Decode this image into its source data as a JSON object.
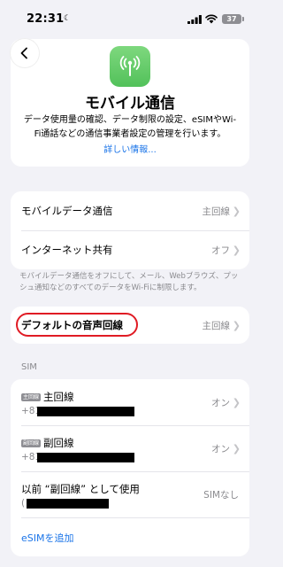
{
  "status_bar": {
    "time": "22:31",
    "battery": "37"
  },
  "header": {
    "title": "モバイル通信",
    "description": "データ使用量の確認、データ制限の設定、eSIMやWi-Fi通話などの通信事業者設定の管理を行います。",
    "learn_more": "詳しい情報..."
  },
  "group1": {
    "rows": [
      {
        "label": "モバイルデータ通信",
        "value": "主回線"
      },
      {
        "label": "インターネット共有",
        "value": "オフ"
      }
    ],
    "footer": "モバイルデータ通信をオフにして、メール、Webブラウズ、プッシュ通知などのすべてのデータをWi-Fiに制限します。"
  },
  "voice_line": {
    "label": "デフォルトの音声回線",
    "value": "主回線"
  },
  "sim_section": {
    "header": "SIM",
    "lines": [
      {
        "badge": "主回線",
        "name": "主回線",
        "number_prefix": "+81",
        "value": "オン"
      },
      {
        "badge": "副回線",
        "name": "副回線",
        "number_prefix": "+81",
        "value": "オン"
      }
    ],
    "former": {
      "label": "以前 “副回線” として使用",
      "number_prefix": "(",
      "value": "SIMなし"
    },
    "add_esim": "eSIMを追加"
  },
  "colors": {
    "accent": "#1a74e8",
    "highlight": "#e01b24",
    "app_icon": "#5ac55f"
  }
}
